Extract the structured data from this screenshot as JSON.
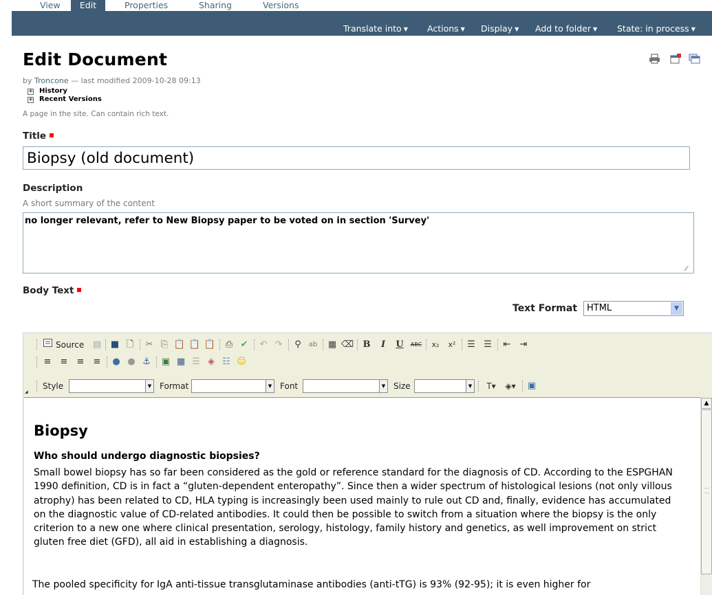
{
  "tabs": [
    {
      "label": "View"
    },
    {
      "label": "Edit",
      "selected": true
    },
    {
      "label": "Properties"
    },
    {
      "label": "Sharing"
    },
    {
      "label": "Versions"
    }
  ],
  "actions": {
    "translate": "Translate into",
    "actions": "Actions",
    "display": "Display",
    "add_to_folder": "Add to folder",
    "state": "State: in process"
  },
  "header": {
    "title": "Edit Document",
    "byline_prefix": "by",
    "author": "Troncone",
    "modified": "— last modified 2009-10-28 09:13",
    "history": "History",
    "recent_versions": "Recent Versions",
    "type_description": "A page in the site. Can contain rich text.",
    "icons": [
      "print-icon",
      "full-screen-icon",
      "send-to-icon"
    ]
  },
  "form": {
    "title_label": "Title",
    "title_value": "Biopsy (old document)",
    "description_label": "Description",
    "description_help": "A short summary of the content",
    "description_value": "no longer relevant, refer to New Biopsy paper to be voted on in section 'Survey'",
    "body_label": "Body Text",
    "text_format_label": "Text Format",
    "text_format_value": "HTML"
  },
  "editor": {
    "source_label": "Source",
    "style_label": "Style",
    "format_label": "Format",
    "font_label": "Font",
    "size_label": "Size",
    "heading": "Biopsy",
    "subheading": "Who should undergo diagnostic biopsies?",
    "paragraph": "Small bowel biopsy has so far been considered as the gold or reference standard for the diagnosis of CD. According to the ESPGHAN 1990 definition, CD is in fact a “gluten-dependent enteropathy”. Since then a wider spectrum of histological lesions (not only villous atrophy) has been related to CD, HLA typing is increasingly been used mainly to rule out CD and, finally, evidence has accumulated on the diagnostic value of CD-related antibodies. It could then be possible to switch from a situation where the biopsy is the only criterion to a new one where clinical presentation, serology, histology, family history and genetics, as well improvement on strict gluten free diet (GFD), all aid in establishing a diagnosis.",
    "paragraph2": "The pooled specificity for IgA anti-tissue transglutaminase antibodies (anti-tTG) is 93% (92-95); it is even higher for"
  },
  "colors": {
    "bar": "#3e5c75",
    "link": "#436976",
    "required": "#ff0000"
  }
}
